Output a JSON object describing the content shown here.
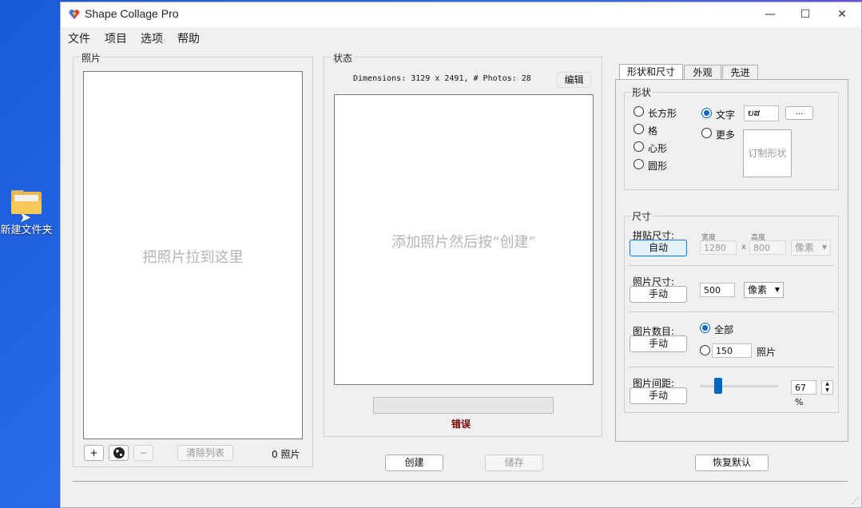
{
  "desktop": {
    "icon_label": "新建文件夹"
  },
  "window": {
    "title": "Shape Collage Pro",
    "controls": {
      "minimize": "—",
      "maximize": "☐",
      "close": "✕"
    }
  },
  "menu": [
    "文件",
    "项目",
    "选项",
    "帮助"
  ],
  "photos": {
    "group_label": "照片",
    "placeholder": "把照片拉到这里",
    "add": "+",
    "remove": "−",
    "clear": "清除列表",
    "count": "0 照片"
  },
  "status": {
    "group_label": "状态",
    "info": "Dimensions: 3129 x 2491, # Photos: 28",
    "edit": "编辑",
    "placeholder": "添加照片然后按“创建”",
    "progress": 0,
    "error": "错误"
  },
  "actions": {
    "create": "创建",
    "save": "储存",
    "reset": "恢复默认"
  },
  "tabs": [
    "形状和尺寸",
    "外观",
    "先进"
  ],
  "shape": {
    "label": "形状",
    "options": [
      "长方形",
      "格",
      "心形",
      "圆形"
    ],
    "text_option": "文字",
    "text_value": "ຍສ",
    "browse": "...",
    "more_option": "更多",
    "custom_shape": "订制形状",
    "selected": "文字"
  },
  "size": {
    "label": "尺寸",
    "collage_size_label": "拼贴尺寸:",
    "collage_mode": "自动",
    "width_label": "宽度",
    "height_label": "高度",
    "width": "1280",
    "times": "x",
    "height": "800",
    "collage_unit": "像素",
    "photo_size_label": "照片尺寸:",
    "photo_mode": "手动",
    "photo_size": "500",
    "photo_unit": "像素",
    "photo_count_label": "图片数目:",
    "count_mode": "手动",
    "all_option": "全部",
    "count_value": "150",
    "count_unit": "照片",
    "count_selected": "全部",
    "spacing_label": "图片间距:",
    "spacing_mode": "手动",
    "spacing_value": "67 %",
    "spacing_fraction": 0.2
  },
  "colors": {
    "accent": "#0067c0",
    "error": "#7a0000"
  }
}
